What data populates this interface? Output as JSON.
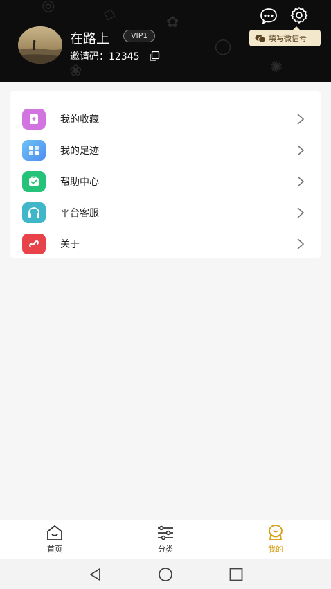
{
  "profile": {
    "username": "在路上",
    "vip_label": "VIP1",
    "invite_text": "邀请码：12345",
    "wechat_button_label": "填写微信号"
  },
  "menu": {
    "items": [
      {
        "label": "我的收藏",
        "icon": "bookmark-icon",
        "color": "#d274e0"
      },
      {
        "label": "我的足迹",
        "icon": "grid-icon",
        "color": "#5aa7f0"
      },
      {
        "label": "帮助中心",
        "icon": "help-icon",
        "color": "#25c27a"
      },
      {
        "label": "平台客服",
        "icon": "headset-icon",
        "color": "#3fb7c9"
      },
      {
        "label": "关于",
        "icon": "link-icon",
        "color": "#e8434a"
      }
    ]
  },
  "bottom_nav": {
    "tabs": [
      {
        "label": "首页",
        "icon": "home-icon"
      },
      {
        "label": "分类",
        "icon": "filter-icon"
      },
      {
        "label": "我的",
        "icon": "profile-icon",
        "active": true
      }
    ]
  },
  "colors": {
    "accent": "#d9a21b",
    "header_bg": "#0d0d0d",
    "wechat_pill_bg": "#f3e7cc"
  }
}
